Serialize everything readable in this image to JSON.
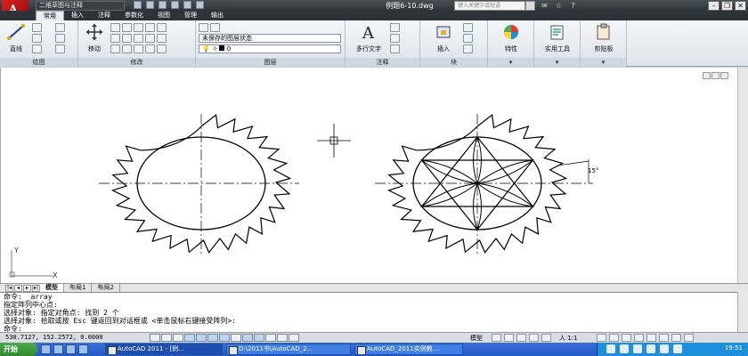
{
  "titlebar": {
    "workspace": "二维草图与注释",
    "file_title": "例题6-10.dwg",
    "search_placeholder": "键入关键字或短语"
  },
  "ribbon_tabs": [
    "常用",
    "插入",
    "注释",
    "参数化",
    "视图",
    "管理",
    "输出"
  ],
  "ribbon": {
    "draw_panel": {
      "line_label": "直线",
      "title": "绘图"
    },
    "modify_panel": {
      "move_label": "移动",
      "title": "修改"
    },
    "layers_panel": {
      "layer_state": "未保存的图层状态",
      "current_layer": "0",
      "title": "图层"
    },
    "annotation_panel": {
      "mtext_label": "多行文字",
      "title": "注释"
    },
    "block_panel": {
      "insert_label": "插入",
      "title": "块"
    },
    "properties_label": "特性",
    "utilities_label": "实用工具",
    "clipboard_label": "剪贴板"
  },
  "canvas": {
    "angle_label": "15°",
    "axis_y": "Y",
    "colors": {
      "background": "#ffffff",
      "geometry": "#000000"
    }
  },
  "layout_tabs": [
    "模型",
    "布局1",
    "布局2"
  ],
  "command_line": [
    "命令:  _array",
    "指定阵列中心点:",
    "选择对象: 指定对角点: 找到 2 个",
    "选择对象:  拾取或按 Esc 键返回到对话框或 <单击鼠标右键接受阵列>:",
    "命令:"
  ],
  "status": {
    "coords": "530.7127, 152.2572, 0.0000",
    "model_label": "模型",
    "annotation_scale": "人 1:1"
  },
  "taskbar": {
    "start": "开始",
    "tasks": [
      "AutoCAD 2011 - [例...",
      "D:\\2011书\\AutoCAD_2...",
      "AutoCAD_2011实例教..."
    ],
    "clock": "19:51"
  }
}
